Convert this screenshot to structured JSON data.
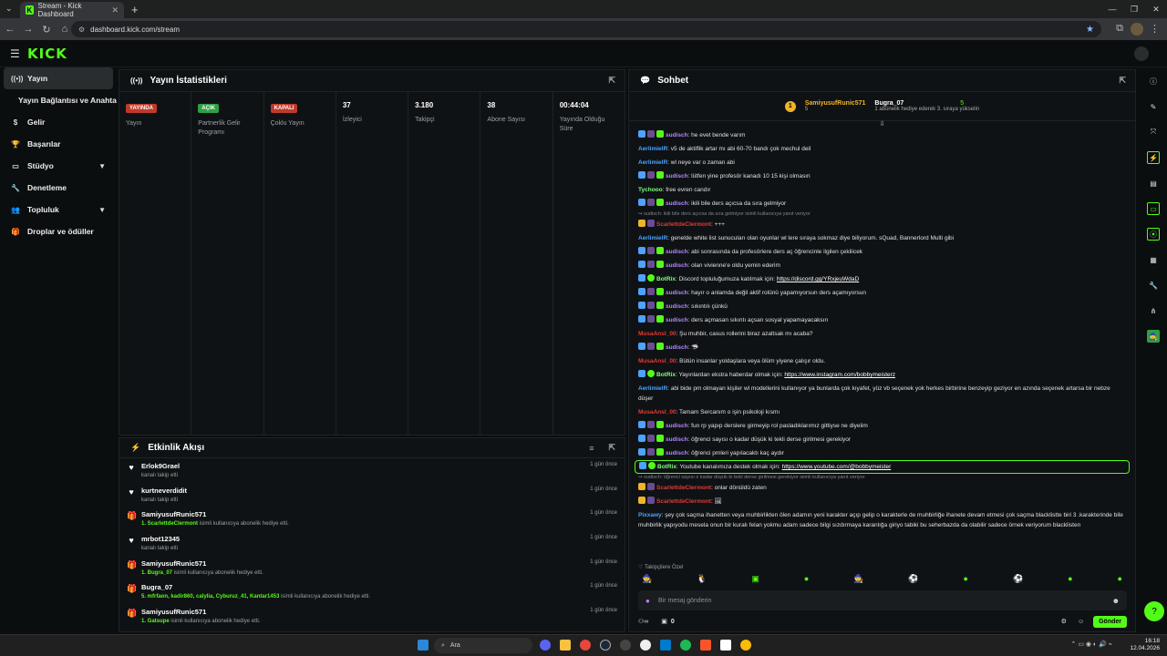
{
  "browser": {
    "tab_title": "Stream - Kick Dashboard",
    "url": "dashboard.kick.com/stream"
  },
  "brand": {
    "logo": "KICK",
    "accent": "#53fc18"
  },
  "sidebar": {
    "items": [
      {
        "label": "Yayın",
        "icon": "broadcast-icon",
        "active": true
      },
      {
        "label": "Yayın Bağlantısı ve Anahtarı",
        "sub": true
      },
      {
        "label": "Gelir",
        "icon": "money-icon"
      },
      {
        "label": "Başarılar",
        "icon": "trophy-icon"
      },
      {
        "label": "Stüdyo",
        "icon": "studio-icon",
        "expandable": true
      },
      {
        "label": "Denetleme",
        "icon": "wrench-icon"
      },
      {
        "label": "Topluluk",
        "icon": "community-icon",
        "expandable": true
      },
      {
        "label": "Droplar ve ödüller",
        "icon": "gift-icon"
      }
    ]
  },
  "stats": {
    "title": "Yayın İstatistikleri",
    "cells": [
      {
        "badge": "YAYINDA",
        "badge_color": "red",
        "label": "Yayın"
      },
      {
        "badge": "AÇIK",
        "badge_color": "green",
        "label": "Partnerlik Gelir Programı"
      },
      {
        "badge": "KAPALI",
        "badge_color": "red",
        "label": "Çoklu Yayın"
      },
      {
        "value": "37",
        "label": "İzleyici"
      },
      {
        "value": "3.180",
        "label": "Takipçi"
      },
      {
        "value": "38",
        "label": "Abone Sayısı"
      },
      {
        "value": "00:44:04",
        "label": "Yayında Olduğu Süre"
      }
    ]
  },
  "activity": {
    "title": "Etkinlik Akışı",
    "items": [
      {
        "user": "Erlok9Grael",
        "desc": "kanalı takip etti",
        "time": "1 gün önce",
        "type": "follow"
      },
      {
        "user": "kurtneverdidit",
        "desc": "kanalı takip etti",
        "time": "1 gün önce",
        "type": "follow"
      },
      {
        "user": "SamiyusufRunic571",
        "highlight": "1. ScarlettdeClermont",
        "desc": "isimli kullanıcıya abonelik hediye etti.",
        "time": "1 gün önce",
        "type": "gift"
      },
      {
        "user": "mrbot12345",
        "desc": "kanalı takip etti",
        "time": "1 gün önce",
        "type": "follow"
      },
      {
        "user": "SamiyusufRunic571",
        "highlight": "1. Bugra_07",
        "desc": "isimli kullanıcıya abonelik hediye etti.",
        "time": "1 gün önce",
        "type": "gift"
      },
      {
        "user": "Bugra_07",
        "highlight": "5. mfrfaon, kadir860, calylia, Cyburuz_41, Kantar1453",
        "desc": "isimli kullanıcıya abonelik hediye etti.",
        "time": "1 gün önce",
        "type": "gift"
      },
      {
        "user": "SamiyusufRunic571",
        "highlight": "1. Gatsuре",
        "desc": "isimli kullanıcıya abonelik hediye etti.",
        "time": "1 gün önce",
        "type": "gift"
      }
    ]
  },
  "chat": {
    "title": "Sohbet",
    "top_gifter": {
      "name": "SamiyusufRunic571",
      "count": "5"
    },
    "second": {
      "name": "Bugra_07",
      "count": "5",
      "note": "1 abonelik hediye ederek 3. sıraya yükselin"
    },
    "messages": [
      {
        "user": "sudisch",
        "color": "#b388ff",
        "text": ": he evet bende varım",
        "badges": true
      },
      {
        "user": "AerlimielR",
        "color": "#4da3ff",
        "text": ": v5 de aktiflik artar mı abi 60-70 bandı çok mechul deil"
      },
      {
        "user": "AerlimielR",
        "color": "#4da3ff",
        "text": ": wl neye var o zaman abi"
      },
      {
        "user": "sudisch",
        "color": "#b388ff",
        "text": ": lütfen yine profesör kanadı 10 15 kişi olmasın",
        "badges": true
      },
      {
        "user": "Tychooo",
        "color": "#7fff7f",
        "text": ": free evren candır"
      },
      {
        "user": "sudisch",
        "color": "#b388ff",
        "text": ": ikili bile ders açıcsa da sıra gelmiyor",
        "badges": true
      },
      {
        "reply": "sudisch: ikili bile ders açıcsa da sıra gelmiyor isimli kullanıcıya yanıt veriyor"
      },
      {
        "user": "ScarlettdeClermont",
        "color": "#e53935",
        "text": ": +++",
        "crown": true
      },
      {
        "user": "AerlimielR",
        "color": "#4da3ff",
        "text": ": genelde white list sunucuları olan oyunlar wl lere sıraya sokmaz diye biliyorum. sQuad, Bannerlord Multi gibi"
      },
      {
        "user": "sudisch",
        "color": "#b388ff",
        "text": ": abi sonrasında da profesörlere ders aç öğrencinle ilgilen çekilicek",
        "badges": true
      },
      {
        "user": "sudisch",
        "color": "#b388ff",
        "text": ": olan vivienne'e oldu yemin ederim",
        "badges": true
      },
      {
        "user": "BotRix",
        "color": "#7fff7f",
        "text": ": Discord topluluğumuza katılmak için: ",
        "link": "https://discord.gg/YRxjeuWdaD",
        "bot": true
      },
      {
        "user": "sudisch",
        "color": "#b388ff",
        "text": ": hayır o anlamda değil aktif rolünü yapamıyorsun ders açamıyorsun",
        "badges": true
      },
      {
        "user": "sudisch",
        "color": "#b388ff",
        "text": ": sıkıntılı çünkü",
        "badges": true
      },
      {
        "user": "sudisch",
        "color": "#b388ff",
        "text": ": ders açmasan sıkıntı açsan sosyal yapamayacaksın",
        "badges": true
      },
      {
        "user": "MusaAnsl_00",
        "color": "#e53935",
        "text": ": Şu muhbir, casus rollerini biraz azaltsak mı acaba?"
      },
      {
        "user": "sudisch",
        "color": "#b388ff",
        "text": ": 🦈",
        "badges": true
      },
      {
        "user": "MusaAnsl_00",
        "color": "#e53935",
        "text": ": Bütün insanlar yoldaşlara veya ölüm yiyene çalışır oldu."
      },
      {
        "user": "BotRix",
        "color": "#7fff7f",
        "text": ": Yayınlardan ekstra haberdar olmak için: ",
        "link": "https://www.instagram.com/bobbymeisterz",
        "bot": true
      },
      {
        "user": "AerlimielR",
        "color": "#4da3ff",
        "text": ": abi bide pm olmayan kişiler wl modellerini kullanıyor ya bunlarda çok kıyafet, yüz vb seçenek yok herkes birbirine benzeyip geziyor en azında seçenek artarsa bir nebze düşer"
      },
      {
        "user": "MusaAnsl_00",
        "color": "#e53935",
        "text": ": Tamam Sercanım o işin psikoloji kısmı"
      },
      {
        "user": "sudisch",
        "color": "#b388ff",
        "text": ": fun rp yapıp derslere girmeyip rol pasladıklarımız gittiyse ne diyelim",
        "badges": true
      },
      {
        "user": "sudisch",
        "color": "#b388ff",
        "text": ": öğrenci sayısı o kadar düşük ki tekli derse girilmesi gerekiyor",
        "badges": true
      },
      {
        "user": "sudisch",
        "color": "#b388ff",
        "text": ": öğrenci pmleri yapılacaktı kaç aydır",
        "badges": true
      },
      {
        "user": "BotRix",
        "color": "#7fff7f",
        "text": ": Youtube kanalımıza destek olmak için: ",
        "link": "https://www.youtube.com/@bobbymeister",
        "bot": true,
        "highlight": true
      },
      {
        "reply": "sudisch: öğrenci sayısı o kadar düşük ki tekli derse girilmesi gerekiyor isimli kullanıcıya yanıt veriyor"
      },
      {
        "user": "ScarlettdeClermont",
        "color": "#e53935",
        "text": ": onlar dönüldü zaten",
        "crown": true
      },
      {
        "user": "ScarlettdeClermont",
        "color": "#e53935",
        "text": ": 🖼",
        "crown": true
      },
      {
        "user": "Pixxawy",
        "color": "#4da3ff",
        "text": ": şey çok saçma ihanetten veya muhbirlikten ölen adamın yeni karakter açıp gelip o karakterle de muhbirliğe ihanete devam etmesi çok saçma blacklistte biri 3 .karakterinde bile muhbirlik yapıyodu mesela onun bir kuralı felan yokmu adam sadece bilgi sızdırmaya karanlığa giriyo tabiki bu seherbazda da olabilir sadece örnek veriyorum blacklisten"
      }
    ],
    "followers_only": "Takipçilere Özel",
    "input_placeholder": "Bir mesaj gönderin",
    "counter": "0",
    "send_label": "Gönder"
  },
  "taskbar": {
    "search": "Ara",
    "time": "16:18",
    "date": "12.04.2026"
  }
}
